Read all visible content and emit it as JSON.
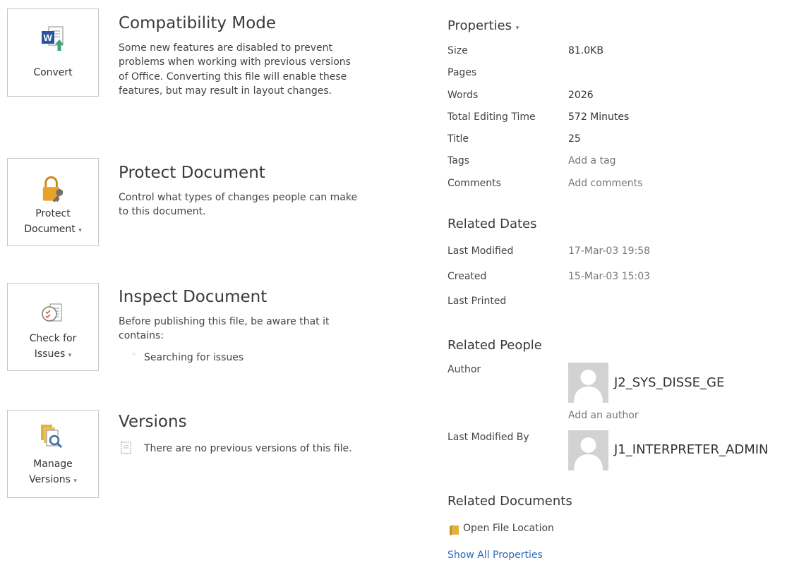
{
  "left": {
    "compat": {
      "button_label": "Convert",
      "title": "Compatibility Mode",
      "description": "Some new features are disabled to prevent problems when working with previous versions of Office. Converting this file will enable these features, but may result in layout changes."
    },
    "protect": {
      "button_line1": "Protect",
      "button_line2": "Document",
      "title": "Protect Document",
      "description": "Control what types of changes people can make to this document."
    },
    "inspect": {
      "button_line1": "Check for",
      "button_line2": "Issues",
      "title": "Inspect Document",
      "description": "Before publishing this file, be aware that it contains:",
      "bullet": "Searching for issues"
    },
    "versions": {
      "button_line1": "Manage",
      "button_line2": "Versions",
      "title": "Versions",
      "description": "There are no previous versions of this file."
    }
  },
  "properties": {
    "heading": "Properties",
    "rows": [
      {
        "label": "Size",
        "value": "81.0KB"
      },
      {
        "label": "Pages",
        "value": ""
      },
      {
        "label": "Words",
        "value": "2026"
      },
      {
        "label": "Total Editing Time",
        "value": "572 Minutes"
      },
      {
        "label": "Title",
        "value": "25"
      },
      {
        "label": "Tags",
        "value": "Add a tag"
      },
      {
        "label": "Comments",
        "value": "Add comments"
      }
    ]
  },
  "related_dates": {
    "heading": "Related Dates",
    "rows": [
      {
        "label": "Last Modified",
        "value": "17-Mar-03 19:58"
      },
      {
        "label": "Created",
        "value": "15-Mar-03 15:03"
      },
      {
        "label": "Last Printed",
        "value": ""
      }
    ]
  },
  "related_people": {
    "heading": "Related People",
    "author_label": "Author",
    "author_name": "J2_SYS_DISSE_GE",
    "add_author": "Add an author",
    "modified_label": "Last Modified By",
    "modified_name": "J1_INTERPRETER_ADMIN"
  },
  "related_documents": {
    "heading": "Related Documents",
    "open_location": "Open File Location",
    "show_all": "Show All Properties"
  },
  "colors": {
    "link": "#2a6ab8",
    "word_blue": "#2b579a",
    "lock_gold": "#e8a32c",
    "folder_yellow": "#e2b33c"
  }
}
